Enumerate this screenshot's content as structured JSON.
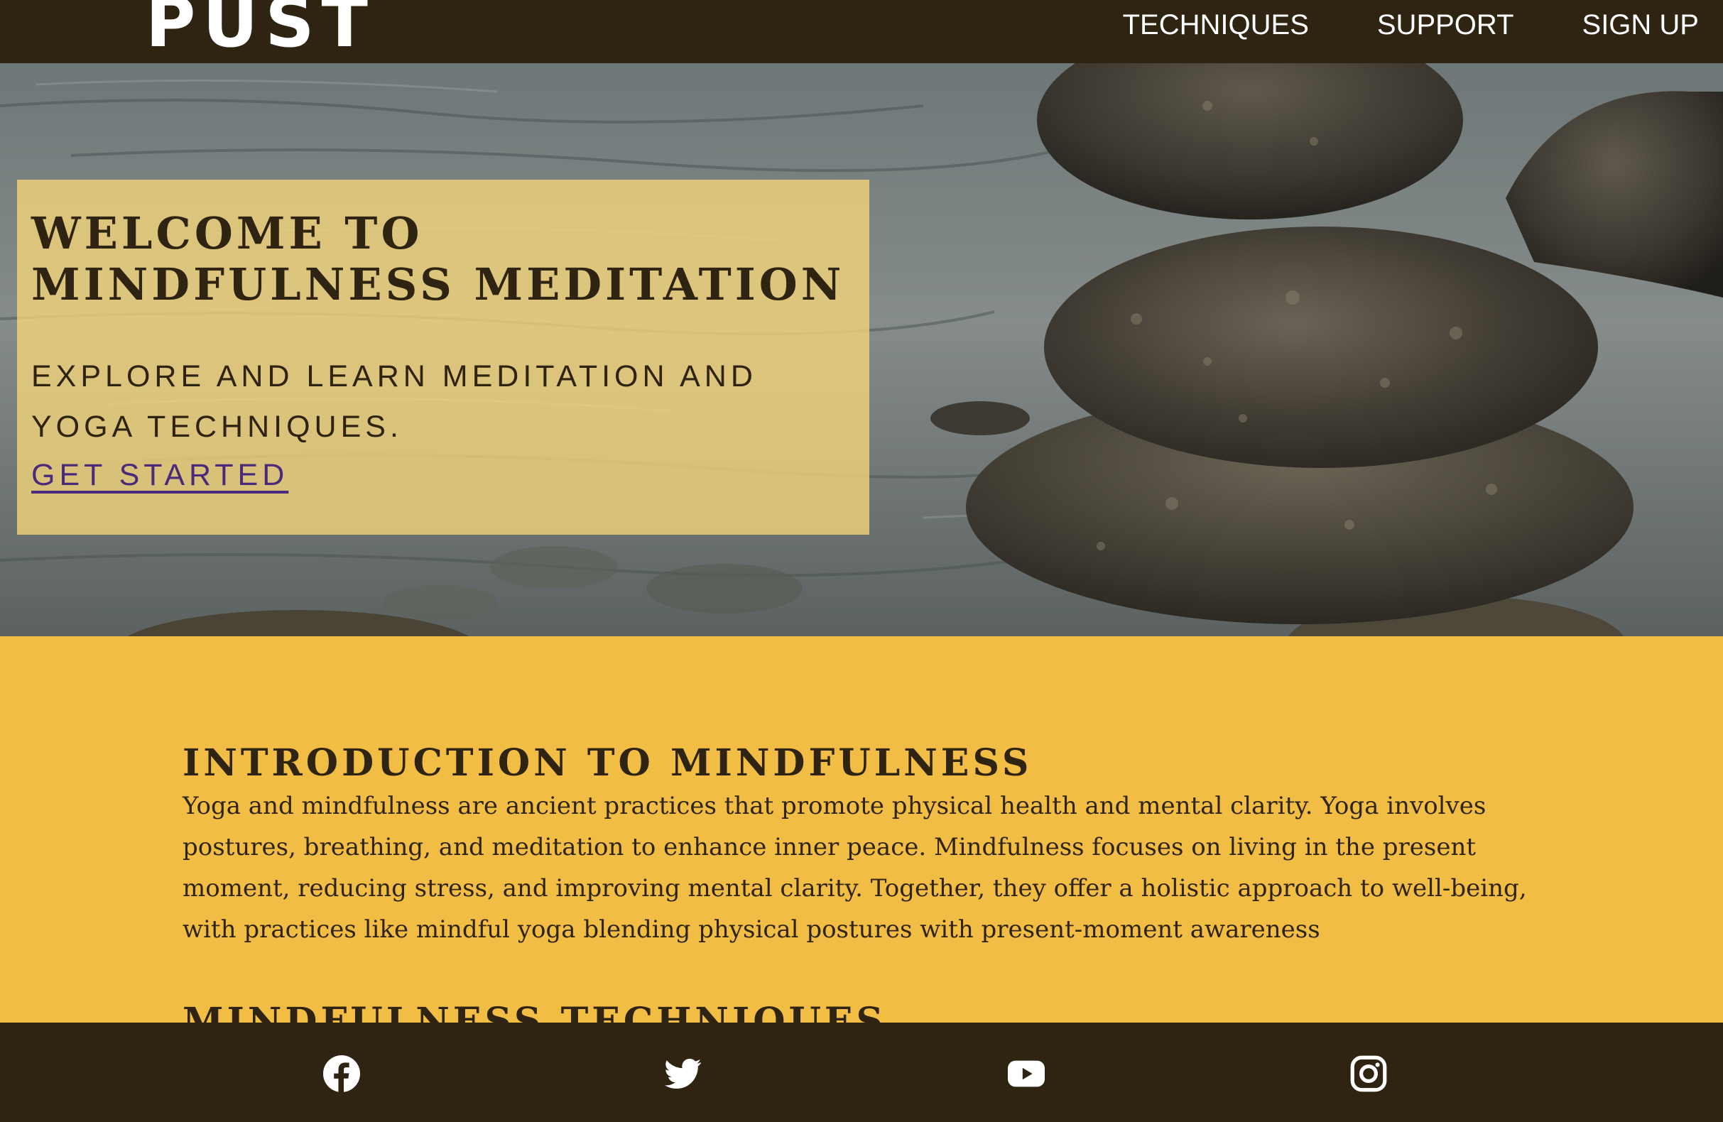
{
  "brand": {
    "logo": "PUST"
  },
  "nav": {
    "items": [
      {
        "label": "TECHNIQUES"
      },
      {
        "label": "SUPPORT"
      },
      {
        "label": "SIGN UP"
      }
    ]
  },
  "hero": {
    "title": "WELCOME TO MINDFULNESS MEDITATION",
    "subtitle": "EXPLORE AND LEARN MEDITATION AND YOGA TECHNIQUES.",
    "cta": "GET STARTED",
    "background": "stacked stones in water"
  },
  "intro": {
    "title": "INTRODUCTION TO MINDFULNESS",
    "body": "Yoga and mindfulness are ancient practices that promote physical health and mental clarity. Yoga involves postures, breathing, and meditation to enhance inner peace. Mindfulness focuses on living in the present moment, reducing stress, and improving mental clarity. Together, they offer a holistic approach to well-being, with practices like mindful yoga blending physical postures with present-moment awareness",
    "next_title": "MINDFULNESS TECHNIQUES"
  },
  "footer": {
    "social": [
      {
        "icon": "facebook-icon"
      },
      {
        "icon": "twitter-icon"
      },
      {
        "icon": "youtube-icon"
      },
      {
        "icon": "instagram-icon"
      }
    ]
  },
  "colors": {
    "dark_brown": "#2f2412",
    "accent_yellow": "#f1bd45",
    "card_yellow": "#f6d67a",
    "link_purple": "#4a2a7a",
    "white": "#ffffff"
  }
}
